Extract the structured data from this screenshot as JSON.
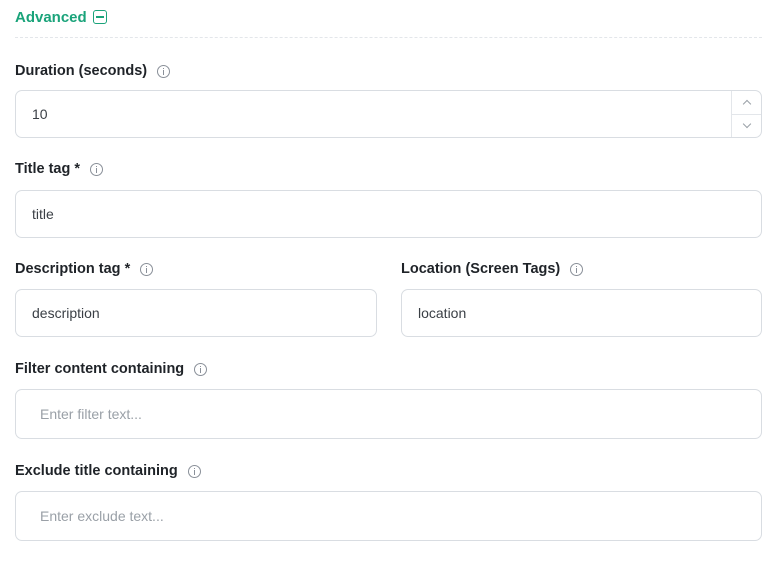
{
  "section": {
    "title": "Advanced",
    "accent": "#1aa37a"
  },
  "fields": {
    "duration": {
      "label": "Duration (seconds)",
      "value": "10"
    },
    "title_tag": {
      "label": "Title tag *",
      "value": "title"
    },
    "description_tag": {
      "label": "Description tag *",
      "value": "description"
    },
    "location": {
      "label": "Location (Screen Tags)",
      "value": "location"
    },
    "filter_content": {
      "label": "Filter content containing",
      "placeholder": "Enter filter text..."
    },
    "exclude_title": {
      "label": "Exclude title containing",
      "placeholder": "Enter exclude text..."
    }
  },
  "icons": {
    "info": "info-icon",
    "collapse": "minus-square-icon",
    "step_up": "chevron-up-icon",
    "step_down": "chevron-down-icon"
  }
}
